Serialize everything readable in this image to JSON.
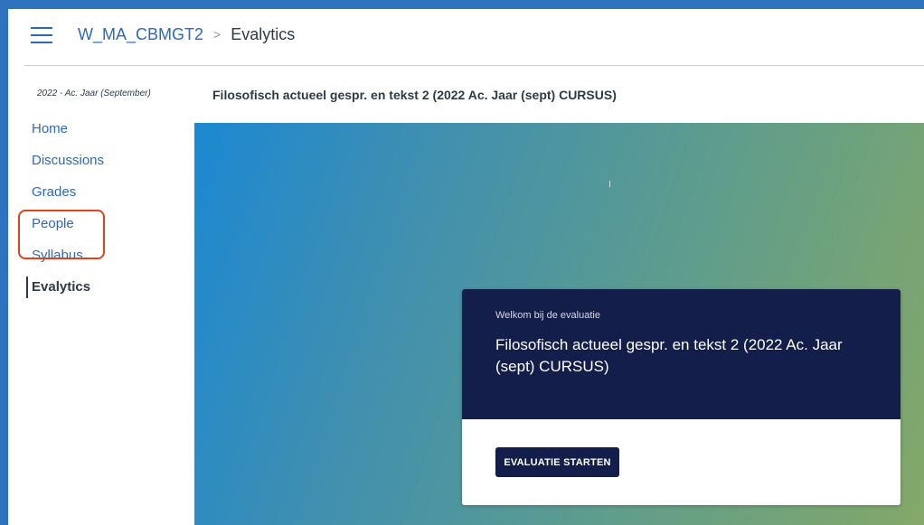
{
  "header": {
    "course_code": "W_MA_CBMGT2",
    "separator": ">",
    "current_page": "Evalytics"
  },
  "sidebar": {
    "term": "2022 - Ac. Jaar (September)",
    "items": [
      {
        "label": "Home"
      },
      {
        "label": "Discussions"
      },
      {
        "label": "Grades"
      },
      {
        "label": "People"
      },
      {
        "label": "Syllabus"
      },
      {
        "label": "Evalytics",
        "active": true
      }
    ]
  },
  "main": {
    "course_title": "Filosofisch actueel gespr. en tekst 2 (2022 Ac. Jaar (sept) CURSUS)"
  },
  "card": {
    "welcome": "Welkom bij de evaluatie",
    "title": "Filosofisch actueel gespr. en tekst 2 (2022 Ac. Jaar (sept) CURSUS)",
    "button_label": "EVALUATIE STARTEN"
  },
  "colors": {
    "frame": "#2f73bf",
    "link": "#2d6ab5",
    "card_header": "#131e4a",
    "highlight": "#e0421a"
  },
  "icons": {
    "menu": "hamburger-icon"
  }
}
